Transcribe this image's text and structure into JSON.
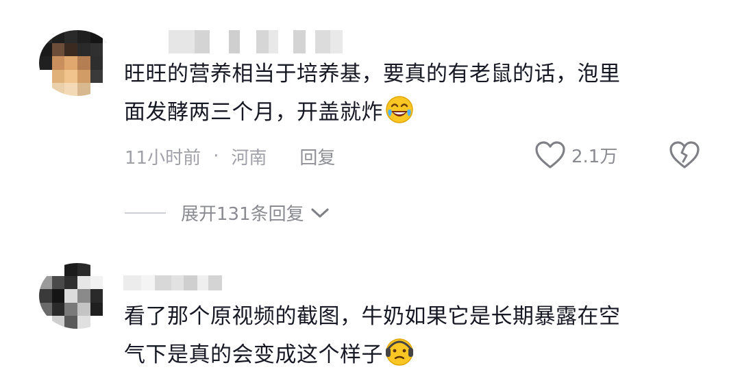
{
  "comments": [
    {
      "text_line1": "旺旺的营养相当于培养基，要真的有老鼠的话，泡里",
      "text_line2": "面发酵两三个月，开盖就炸",
      "emoji": "laughing-crying-emoji",
      "time": "11小时前",
      "separator": "·",
      "location": "河南",
      "reply_label": "回复",
      "like_count": "2.1万",
      "expand_replies": "展开131条回复"
    },
    {
      "text_line1": "看了那个原视频的截图，牛奶如果它是长期暴露在空",
      "text_line2": "气下是真的会变成这个样子",
      "emoji": "worried-face-emoji"
    }
  ],
  "colors": {
    "text": "#161823",
    "meta": "#a0a1a8",
    "divider": "#cfd0d4"
  }
}
